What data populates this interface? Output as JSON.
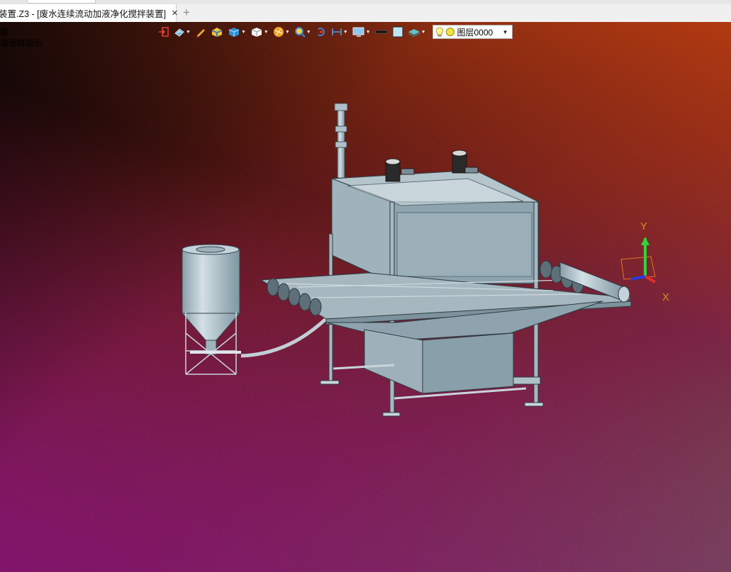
{
  "tab": {
    "title": "装置.Z3 - [废水连续流动加液净化搅拌装置]",
    "close_icon": "×",
    "add_icon": "+"
  },
  "viewport": {
    "hint_line1": "建",
    "hint_line2": "请选择提示",
    "colors": {
      "bg_top_left": "#1c0c0c",
      "bg_top_right": "#b23a12",
      "bg_bottom_left": "#82146e",
      "bg_bottom_right": "#745058",
      "model_steel": "#8fa3ad"
    }
  },
  "toolbar": {
    "icons": [
      "exit-icon",
      "display-mode-icon",
      "pencil-icon",
      "shaded-box-icon",
      "solid-cube-icon",
      "wireframe-cube-icon",
      "render-sphere-icon",
      "zoom-icon",
      "rotate-icon",
      "dimension-icon",
      "monitor-icon",
      "line-style-icon",
      "color-square-icon",
      "layers-icon"
    ],
    "layer_select": {
      "value": "图层0000",
      "icons": [
        "lightbulb-icon",
        "yellow-dot-icon"
      ]
    }
  },
  "triad": {
    "x_label": "X",
    "y_label": "Y"
  }
}
